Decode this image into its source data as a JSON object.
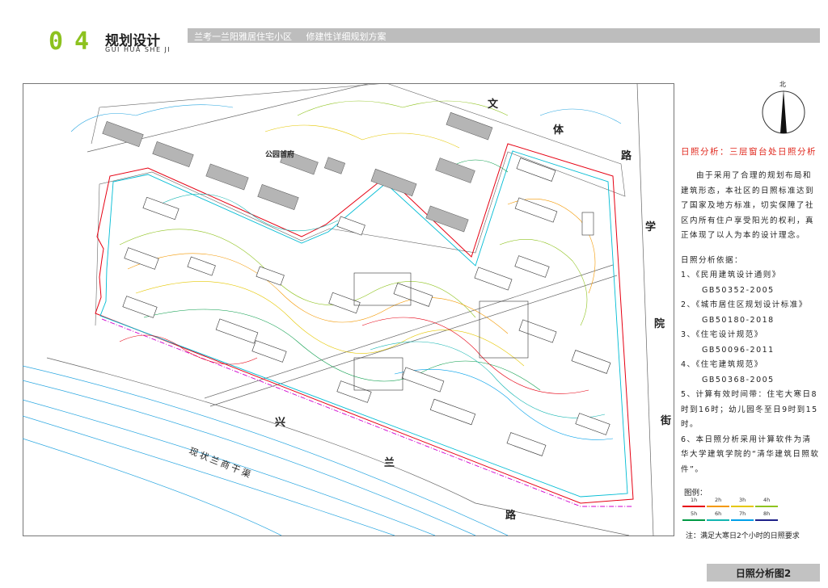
{
  "header": {
    "section_number": "04",
    "title": "规划设计",
    "pinyin": "GUI HUA SHE JI",
    "banner": "兰考一兰阳雅居住宅小区     修建性详细规划方案"
  },
  "plan": {
    "road_north": [
      "文",
      "体",
      "路"
    ],
    "road_east": [
      "学",
      "院",
      "街"
    ],
    "road_south": [
      "兴",
      "兰",
      "路"
    ],
    "canal": "现状兰商干渠",
    "neighbor_label": "公园首府",
    "north_label": "北"
  },
  "sidebar": {
    "heading": "日照分析：三层窗台处日照分析",
    "paragraph": "由于采用了合理的规划布局和建筑形态，本社区的日照标准达到了国家及地方标准，切实保障了社区内所有住户享受阳光的权利，真正体现了以人为本的设计理念。",
    "basis_title": "日照分析依据：",
    "items": [
      {
        "text": "1、《民用建筑设计通则》",
        "indent": false
      },
      {
        "text": "GB50352-2005",
        "indent": true
      },
      {
        "text": "2、《城市居住区规划设计标准》",
        "indent": false
      },
      {
        "text": "GB50180-2018",
        "indent": true
      },
      {
        "text": "3、《住宅设计规范》",
        "indent": false
      },
      {
        "text": "GB50096-2011",
        "indent": true
      },
      {
        "text": "4、《住宅建筑规范》",
        "indent": false
      },
      {
        "text": "GB50368-2005",
        "indent": true
      },
      {
        "text": "5、计算有效时间带：住宅大寒日8时到16时；幼儿园冬至日9时到15时。",
        "indent": false
      },
      {
        "text": "6、本日照分析采用计算软件为清华大学建筑学院的“清华建筑日照软件”。",
        "indent": false
      }
    ]
  },
  "legend": {
    "title": "图例：",
    "items": [
      {
        "label": "1h",
        "color": "#e60012"
      },
      {
        "label": "2h",
        "color": "#f39800"
      },
      {
        "label": "3h",
        "color": "#e5c700"
      },
      {
        "label": "4h",
        "color": "#8fc31f"
      },
      {
        "label": "5h",
        "color": "#009944"
      },
      {
        "label": "6h",
        "color": "#13b5b1"
      },
      {
        "label": "7h",
        "color": "#00a0e9"
      },
      {
        "label": "8h",
        "color": "#1d2088"
      }
    ]
  },
  "note": "注：满足大寒日2个小时的日照要求",
  "footer": "日照分析图2",
  "colors": {
    "accent_green": "#8dc21f",
    "banner_gray": "#bdbdbd",
    "heading_red": "#e0261b",
    "boundary_red": "#e60012",
    "boundary_magenta": "#d000d0",
    "boundary_cyan": "#00bcd4",
    "contour_cyan": "#29a6e0"
  }
}
